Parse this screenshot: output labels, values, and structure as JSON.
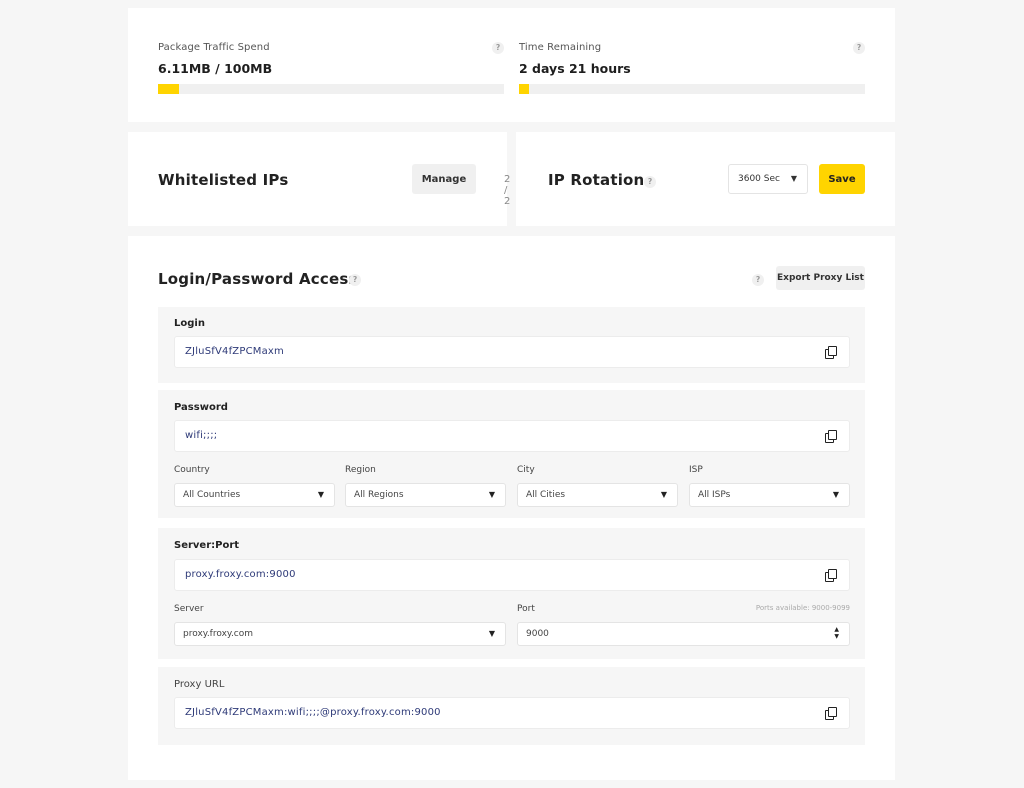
{
  "traffic": {
    "spend_label": "Package Traffic Spend",
    "spend_value": "6.11MB / 100MB",
    "spend_fraction": 0.061,
    "time_label": "Time Remaining",
    "time_value": "2 days 21 hours",
    "time_fraction": 0.03,
    "help_glyph": "?"
  },
  "whitelist": {
    "title": "Whitelisted IPs",
    "count": "2 / 2",
    "manage_label": "Manage"
  },
  "rotation": {
    "title": "IP Rotation",
    "selected": "3600 Sec",
    "save_label": "Save"
  },
  "access": {
    "title": "Login/Password Access",
    "export_label": "Export Proxy List",
    "login": {
      "label": "Login",
      "value": "ZJluSfV4fZPCMaxm"
    },
    "password": {
      "label": "Password",
      "value": "wifi;;;;",
      "country_label": "Country",
      "country_value": "All Countries",
      "region_label": "Region",
      "region_value": "All Regions",
      "city_label": "City",
      "city_value": "All Cities",
      "isp_label": "ISP",
      "isp_value": "All ISPs"
    },
    "server_port": {
      "label": "Server:Port",
      "value": "proxy.froxy.com:9000",
      "server_label": "Server",
      "server_value": "proxy.froxy.com",
      "port_label": "Port",
      "port_value": "9000",
      "ports_note": "Ports available: 9000-9099"
    },
    "proxy_url": {
      "label": "Proxy URL",
      "value": "ZJluSfV4fZPCMaxm:wifi;;;;@proxy.froxy.com:9000"
    }
  },
  "colors": {
    "accent": "#ffd400",
    "value_text": "#2e3a78",
    "background": "#f6f6f6"
  },
  "icons": {
    "help": "question-icon",
    "copy": "copy-icon",
    "caret": "caret-down-icon"
  }
}
